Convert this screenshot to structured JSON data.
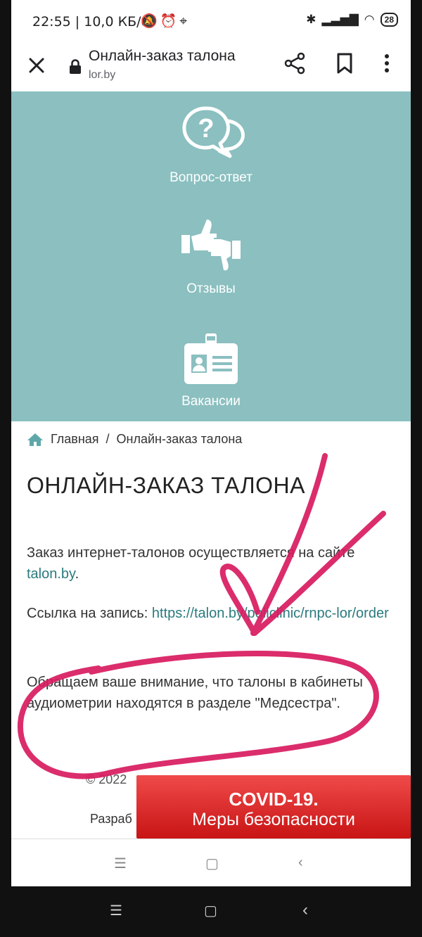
{
  "status": {
    "time_speed": "22:55 | 10,0 КБ/с",
    "battery": "28"
  },
  "browser": {
    "title": "Онлайн-заказ талона",
    "url": "lor.by"
  },
  "menu": [
    {
      "label": "Вопрос-ответ",
      "icon": "question-chat-icon"
    },
    {
      "label": "Отзывы",
      "icon": "thumbs-icon"
    },
    {
      "label": "Вакансии",
      "icon": "id-card-icon"
    }
  ],
  "breadcrumb": {
    "home": "Главная",
    "separator": "/",
    "current": "Онлайн-заказ талона"
  },
  "page": {
    "title": "ОНЛАЙН-ЗАКАЗ ТАЛОНА",
    "p1_text": "Заказ интернет-талонов осуществляется на сайте ",
    "p1_link": "talon.by",
    "p1_end": ".",
    "p2_text": "Ссылка на запись: ",
    "p2_link": "https://talon.by/policlinic/rnpc-lor/order",
    "p3_text": "Обращаем ваше внимание, что талоны в кабинеты аудиометрии находятся в разделе \"Медсестра\"."
  },
  "footer": {
    "copyright": "© 2022",
    "developer": "Разраб"
  },
  "covid_banner": {
    "line1": "COVID-19.",
    "line2": "Меры безопасности"
  },
  "colors": {
    "teal": "#8bbfc0",
    "link": "#2a7a7d",
    "annotation": "#d81b60",
    "banner": "#e53935"
  }
}
